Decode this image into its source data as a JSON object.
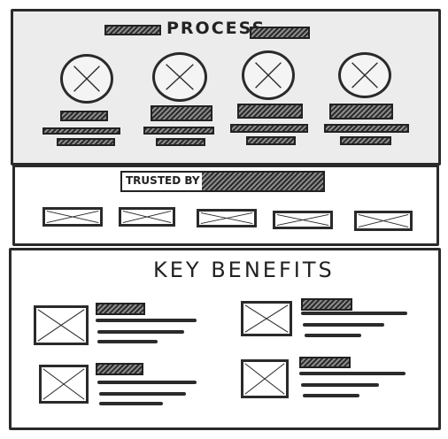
{
  "process": {
    "title": "PROCESS",
    "step_count": 4
  },
  "trusted": {
    "label": "TRUSTED BY",
    "logo_count": 5
  },
  "benefits": {
    "title": "KEY BENEFITS",
    "item_count": 4
  },
  "colors": {
    "ink": "#2a2a2a",
    "process_background": "#ececec",
    "background": "#ffffff"
  },
  "icons": {
    "step": "placeholder-circle-icon",
    "logo": "placeholder-image-icon",
    "benefit": "placeholder-image-icon"
  }
}
